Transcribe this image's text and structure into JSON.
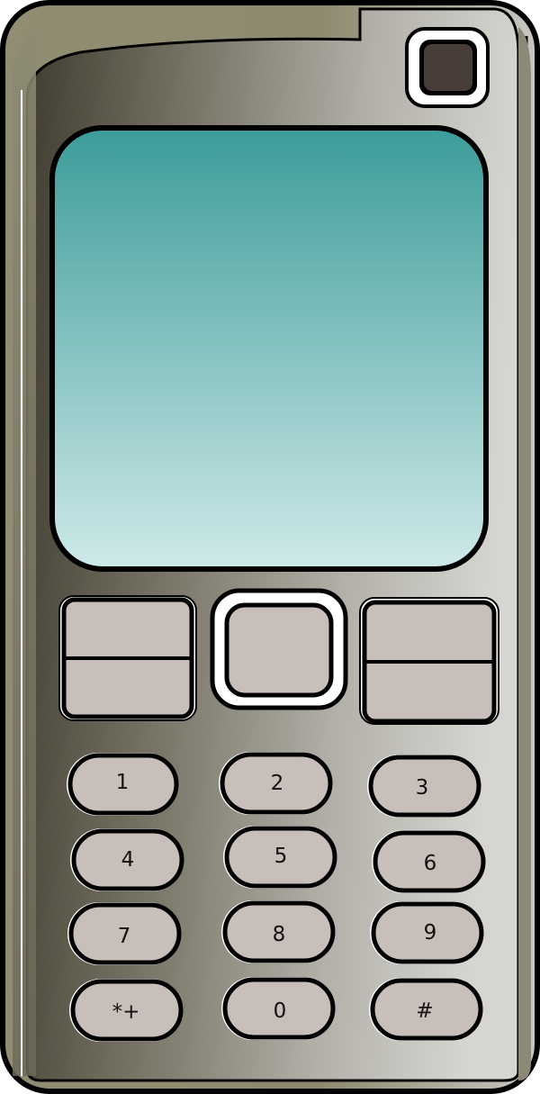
{
  "phone": {
    "colors": {
      "outline": "#000000",
      "body_dark": "#4b483b",
      "body_mid": "#8a8678",
      "body_light": "#d4d3cf",
      "screen_top": "#3d9e9b",
      "screen_bottom": "#cde8e8",
      "key": "#c9bfba",
      "camera_lens": "#493d3a"
    },
    "icons": {
      "camera": "camera-lens-icon",
      "nav": "nav-center-button"
    },
    "keypad": [
      {
        "label": "1"
      },
      {
        "label": "2"
      },
      {
        "label": "3"
      },
      {
        "label": "4"
      },
      {
        "label": "5"
      },
      {
        "label": "6"
      },
      {
        "label": "7"
      },
      {
        "label": "8"
      },
      {
        "label": "9"
      },
      {
        "label": "*+"
      },
      {
        "label": "0"
      },
      {
        "label": "#"
      }
    ]
  }
}
